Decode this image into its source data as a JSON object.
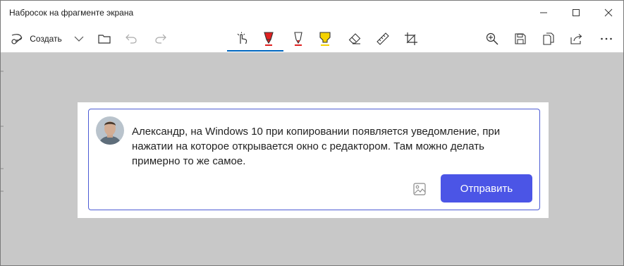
{
  "window": {
    "title": "Набросок на фрагменте экрана"
  },
  "toolbar": {
    "create_label": "Создать",
    "active_tool": "touch-writing"
  },
  "snippet": {
    "comment_text": "Александр, на Windows 10 при копировании появляется уведомление, при нажатии на которое открывается окно с редактором. Там можно делать примерно то же самое.",
    "send_label": "Отправить"
  },
  "colors": {
    "accent": "#0067c0",
    "canvas_bg": "#c8c8c8",
    "send_button": "#4b55e6",
    "comment_border": "#4c5bd4",
    "pen_red": "#e02020",
    "highlighter_yellow": "#f5d200"
  }
}
